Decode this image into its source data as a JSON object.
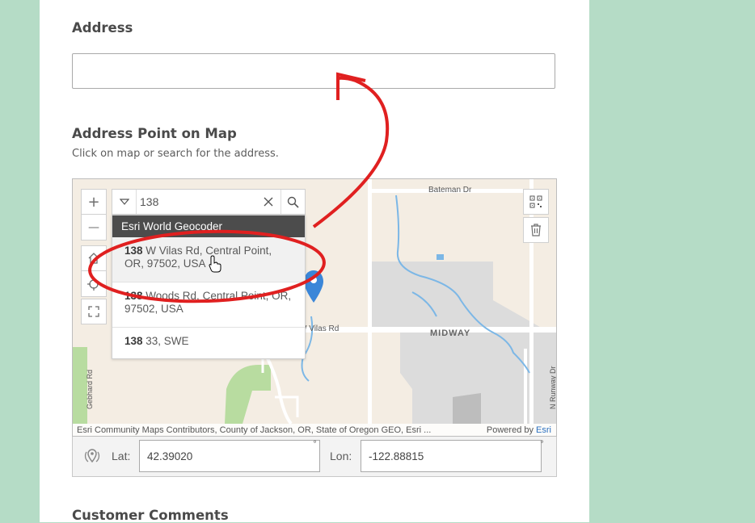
{
  "form": {
    "address_label": "Address",
    "address_value": "",
    "map_label": "Address Point on Map",
    "map_hint": "Click on map or search for the address.",
    "comments_label": "Customer Comments"
  },
  "map": {
    "search_value": "138",
    "suggestions_header": "Esri World Geocoder",
    "suggestions": [
      {
        "bold": "138",
        "text": " W Vilas Rd, Central Point, OR, 97502, USA"
      },
      {
        "bold": "138",
        "text": " Woods Rd, Central Point, OR, 97502, USA"
      },
      {
        "bold": "138",
        "text": " 33, SWE"
      }
    ],
    "streets": {
      "bateman": "Bateman Dr",
      "vilas": "W Vilas Rd",
      "midway": "MIDWAY",
      "gebhard": "Gebhard Rd",
      "runway": "N Runway Dr"
    },
    "attribution": "Esri Community Maps Contributors, County of Jackson, OR, State of Oregon GEO, Esri ...",
    "powered_by": "Powered by",
    "powered_by_link": "Esri",
    "zoom_in": "+",
    "zoom_out": "—"
  },
  "coords": {
    "lat_label": "Lat:",
    "lat_value": "42.39020",
    "lon_label": "Lon:",
    "lon_value": "-122.88815",
    "degree_symbol": "°"
  },
  "colors": {
    "page_bg": "#b5dcc6",
    "annotation_red": "#e02020",
    "pin_blue": "#3b86d8",
    "water": "#7cb7e6",
    "park_green": "#b8dca0"
  },
  "icons": [
    "zoom-in-icon",
    "zoom-out-icon",
    "home-icon",
    "locate-icon",
    "fullscreen-icon",
    "dropdown-icon",
    "clear-icon",
    "search-icon",
    "qr-code-icon",
    "trash-icon",
    "map-pin-icon",
    "geolocate-icon",
    "cursor-hand-icon"
  ]
}
